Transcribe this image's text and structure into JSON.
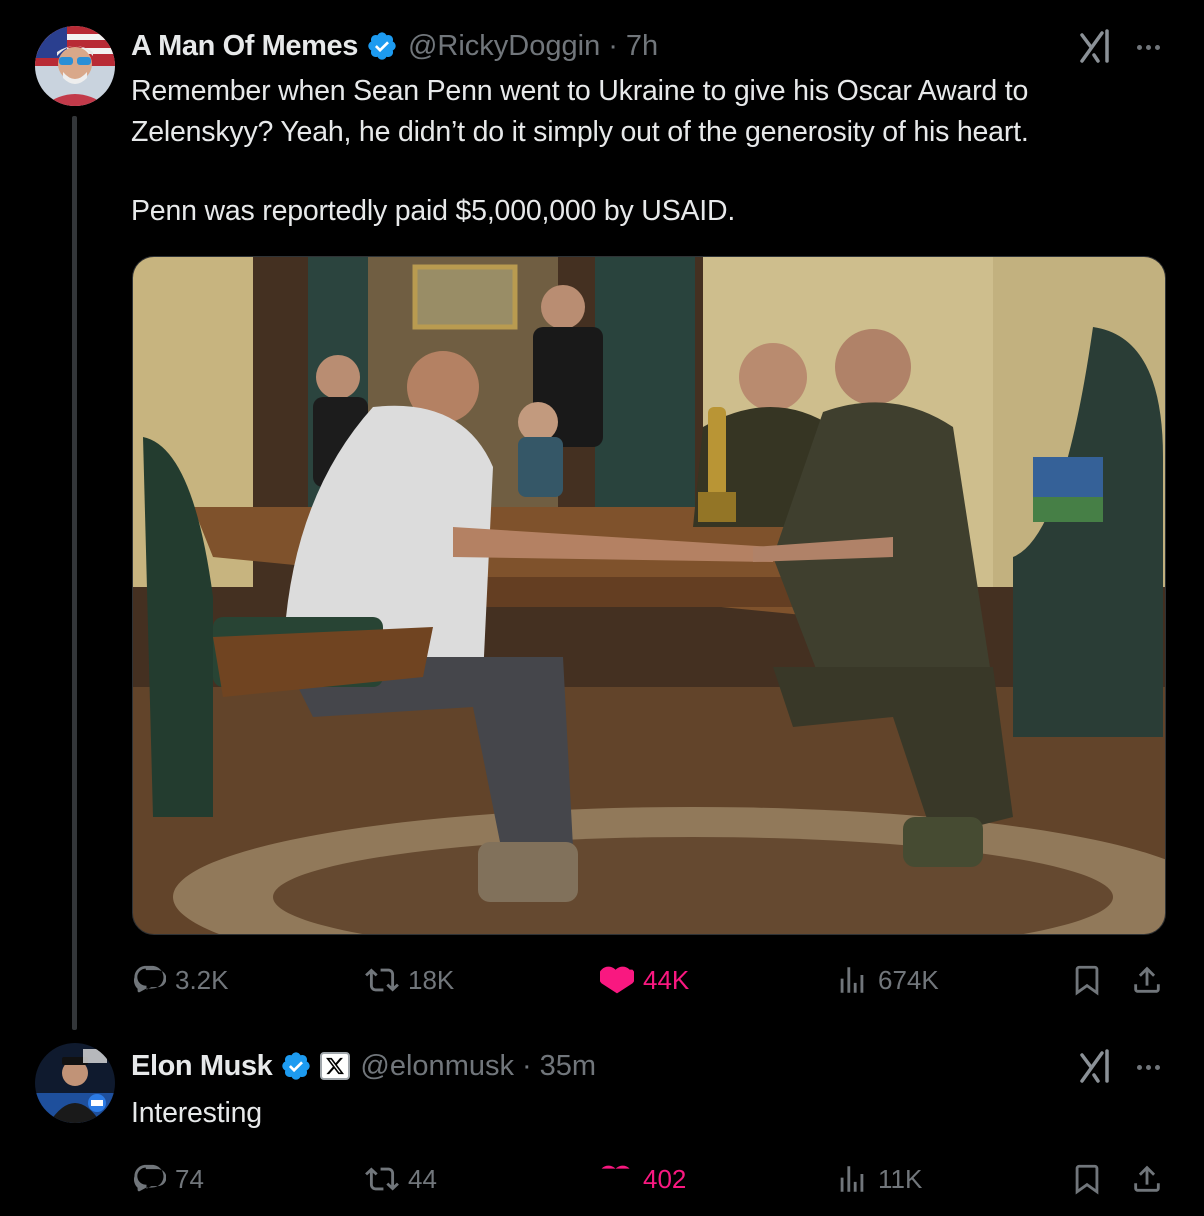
{
  "main_tweet": {
    "author_name": "A Man Of Memes",
    "handle": "@RickyDoggin",
    "separator": "·",
    "time": "7h",
    "text_lines": [
      "Remember when Sean Penn went to Ukraine to give his Oscar Award to",
      "Zelenskyy? Yeah, he didn’t do it simply out of the generosity of his heart.",
      "Penn was reportedly paid $5,000,000 by USAID."
    ],
    "stats": {
      "replies": "3.2K",
      "reposts": "18K",
      "likes": "44K",
      "views": "674K"
    },
    "icons": [
      "verified-badge-icon",
      "grok-icon",
      "more-icon",
      "reply-icon",
      "repost-icon",
      "like-icon",
      "views-icon",
      "bookmark-icon",
      "share-icon"
    ]
  },
  "reply_tweet": {
    "author_name": "Elon Musk",
    "affiliation_badge": "X",
    "handle": "@elonmusk",
    "separator": "·",
    "time": "35m",
    "text": "Interesting",
    "stats": {
      "replies": "74",
      "reposts": "44",
      "likes": "402",
      "views": "11K"
    }
  },
  "colors": {
    "background": "#000000",
    "primary_text": "#e7e9ea",
    "secondary_text": "#71767b",
    "verified_blue": "#1d9bf0",
    "like_pink": "#f91880",
    "thread_line": "#333639"
  }
}
